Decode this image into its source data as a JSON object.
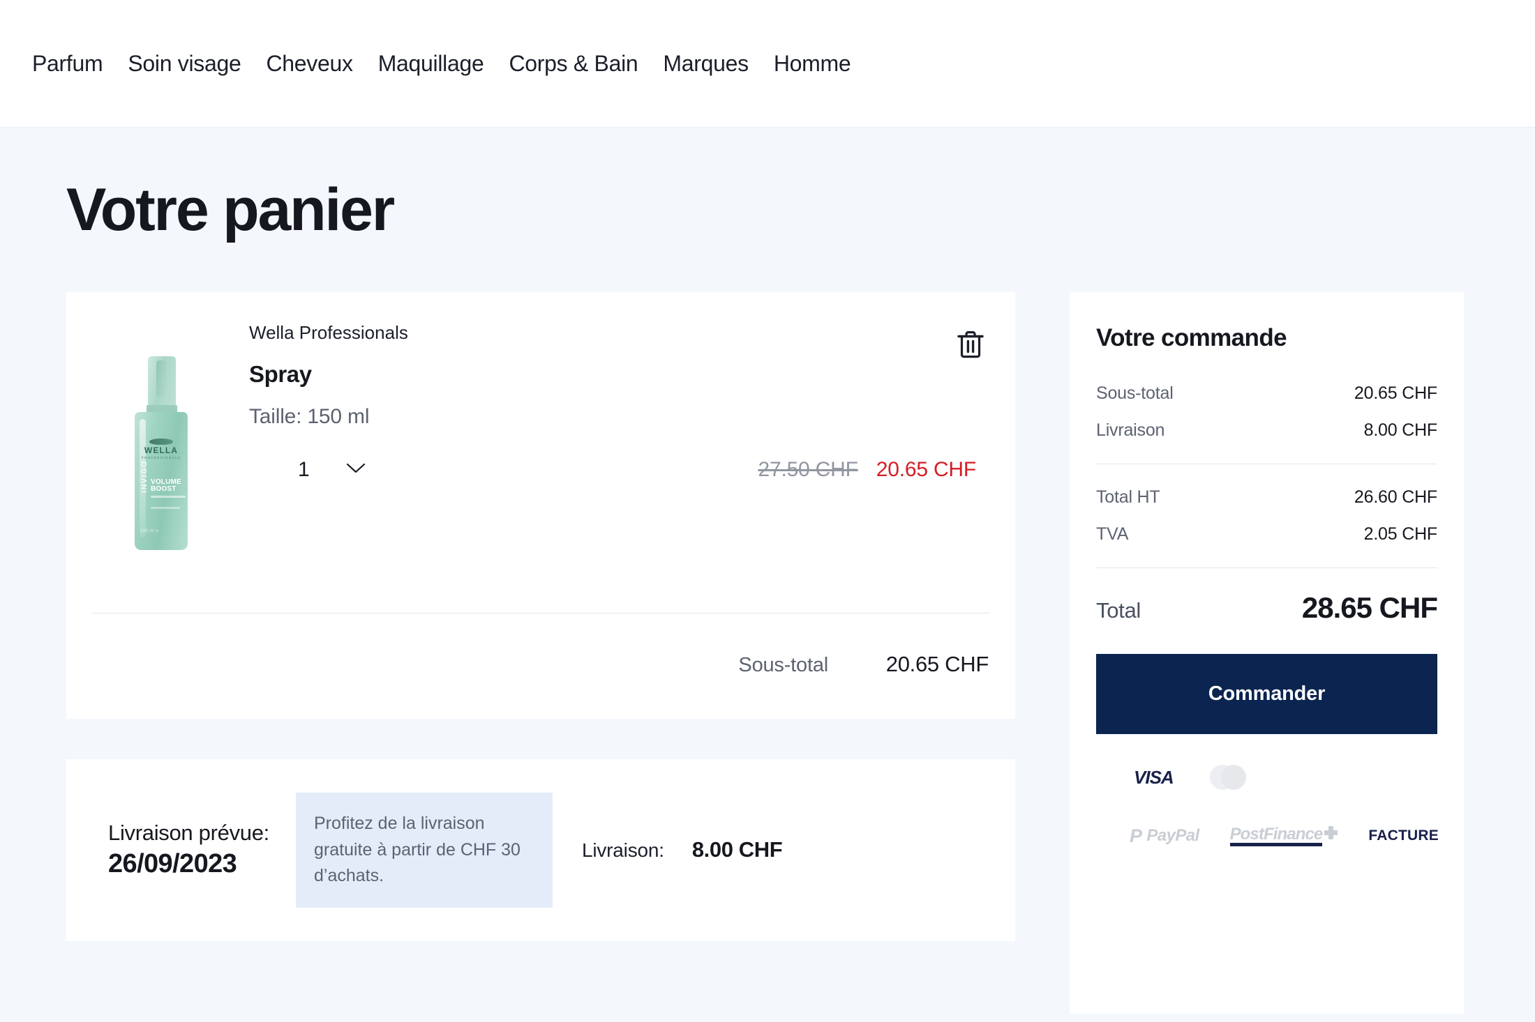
{
  "nav": {
    "items": [
      {
        "label": "Parfum"
      },
      {
        "label": "Soin visage"
      },
      {
        "label": "Cheveux"
      },
      {
        "label": "Maquillage"
      },
      {
        "label": "Corps & Bain"
      },
      {
        "label": "Marques"
      },
      {
        "label": "Homme"
      }
    ]
  },
  "page": {
    "title": "Votre panier",
    "background_color": "#f4f8fd"
  },
  "cart": {
    "item": {
      "brand": "Wella Professionals",
      "name": "Spray",
      "size": "Taille: 150 ml",
      "quantity": "1",
      "price_old": "27.50 CHF",
      "price_new": "20.65 CHF",
      "price_new_color": "#d41d25",
      "image": {
        "brand_text": "WELLA",
        "brand_sub": "PROFESSIONALS",
        "line_name": "INVIGO",
        "variant": "VOLUME BOOST",
        "volume": "150 ml e"
      }
    },
    "subtotal_label": "Sous-total",
    "subtotal_value": "20.65 CHF",
    "delete_icon": "trash-icon",
    "chevron_icon": "chevron-down-icon"
  },
  "delivery": {
    "date_label": "Livraison prévue:",
    "date_value": "26/09/2023",
    "free_shipping_note": "Profitez de la livraison gratuite à partir de CHF 30 d’achats.",
    "note_background": "#e4ecfa",
    "cost_label": "Livraison:",
    "cost_value": "8.00 CHF"
  },
  "summary": {
    "title": "Votre commande",
    "rows": [
      {
        "label": "Sous-total",
        "value": "20.65 CHF"
      },
      {
        "label": "Livraison",
        "value": "8.00 CHF"
      }
    ],
    "tax_rows": [
      {
        "label": "Total HT",
        "value": "26.60 CHF"
      },
      {
        "label": "TVA",
        "value": "2.05 CHF"
      }
    ],
    "total_label": "Total",
    "total_value": "28.65 CHF",
    "order_button": "Commander",
    "order_button_color": "#0b2450",
    "payment_methods": {
      "visa": "VISA",
      "mastercard": "mastercard-icon",
      "paypal_p": "P",
      "paypal": "PayPal",
      "postfinance": "PostFinance",
      "facture": "FACTURE"
    }
  }
}
